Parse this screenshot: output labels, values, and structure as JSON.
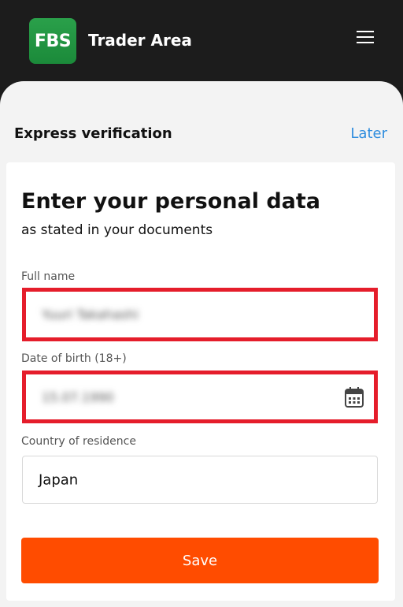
{
  "header": {
    "logo_text": "FBS",
    "app_title": "Trader Area",
    "menu_icon": "hamburger-menu-icon"
  },
  "subheader": {
    "title": "Express verification",
    "later_label": "Later"
  },
  "form": {
    "title": "Enter your personal data",
    "subtitle": "as stated in your documents",
    "full_name": {
      "label": "Full name",
      "value": "Yuuri Takahashi"
    },
    "date_of_birth": {
      "label": "Date of birth (18+)",
      "value": "15.07.1990",
      "icon": "calendar-icon"
    },
    "country": {
      "label": "Country of residence",
      "value": "Japan"
    },
    "save_label": "Save"
  },
  "colors": {
    "brand_green": "#1f9a40",
    "accent_orange": "#ff4c00",
    "link_blue": "#2f8dde",
    "highlight_red": "#e51d2b"
  }
}
